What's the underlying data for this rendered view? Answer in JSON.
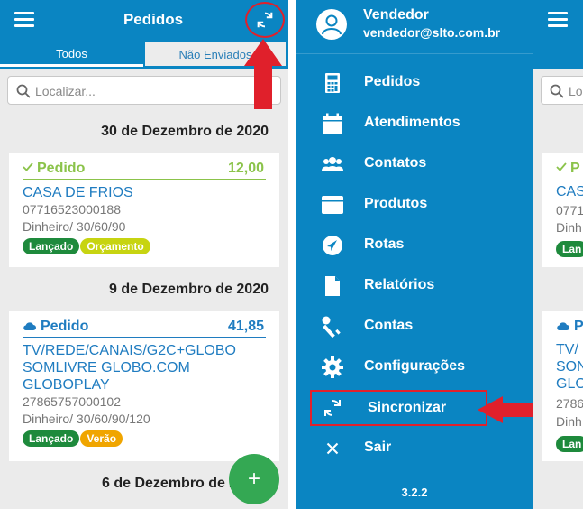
{
  "app": {
    "title": "Pedidos",
    "tabs": [
      {
        "label": "Todos",
        "active": true
      },
      {
        "label": "Não Enviados",
        "active": false
      }
    ],
    "search_placeholder": "Localizar..."
  },
  "orders": [
    {
      "date": "30 de Dezembro de 2020",
      "items": [
        {
          "status": "Pedido",
          "status_icon": "check-icon",
          "status_color": "#8bc34a",
          "amount": "12,00",
          "client": "CASA DE FRIOS",
          "cnpj": "07716523000188",
          "payment": "Dinheiro/ 30/60/90",
          "badges": [
            {
              "label": "Lançado",
              "color": "#1e8a3c"
            },
            {
              "label": "Orçamento",
              "color": "#c7d411"
            }
          ]
        }
      ]
    },
    {
      "date": "9 de Dezembro de 2020",
      "items": [
        {
          "status": "Pedido",
          "status_icon": "cloud-icon",
          "status_color": "#1f7cc0",
          "amount": "41,85",
          "client": "TV/REDE/CANAIS/G2C+GLOBO SOMLIVRE GLOBO.COM GLOBOPLAY",
          "cnpj": "27865757000102",
          "payment": "Dinheiro/ 30/60/90/120",
          "badges": [
            {
              "label": "Lançado",
              "color": "#1e8a3c"
            },
            {
              "label": "Verão",
              "color": "#f0a500"
            }
          ]
        }
      ]
    },
    {
      "date": "6 de Dezembro de 2020",
      "items": []
    }
  ],
  "drawer": {
    "user_name": "Vendedor",
    "user_email": "vendedor@slto.com.br",
    "items": [
      {
        "label": "Pedidos",
        "icon": "calculator-icon"
      },
      {
        "label": "Atendimentos",
        "icon": "calendar-icon"
      },
      {
        "label": "Contatos",
        "icon": "group-icon"
      },
      {
        "label": "Produtos",
        "icon": "box-icon"
      },
      {
        "label": "Rotas",
        "icon": "navigation-icon"
      },
      {
        "label": "Relatórios",
        "icon": "document-icon"
      },
      {
        "label": "Contas",
        "icon": "key-icon"
      },
      {
        "label": "Configurações",
        "icon": "gear-icon"
      },
      {
        "label": "Sincronizar",
        "icon": "sync-icon",
        "highlighted": true
      },
      {
        "label": "Sair",
        "icon": "close-icon"
      }
    ],
    "version": "3.2.2"
  },
  "right_sliver": {
    "search_fragment": "Lo",
    "order1_status": "P",
    "order1_client": "CAS",
    "order1_cnpj": "0771",
    "order1_pay": "Dinh",
    "order1_badge": "Lan",
    "order2_status": "P",
    "order2_line1": "TV/",
    "order2_line2": "SON",
    "order2_line3": "GLO",
    "order2_cnpj": "2786",
    "order2_pay": "Dinh",
    "order2_badge": "Lan"
  },
  "colors": {
    "primary": "#0a85c2",
    "annotation_red": "#e0202b",
    "fab_green": "#34a853"
  }
}
